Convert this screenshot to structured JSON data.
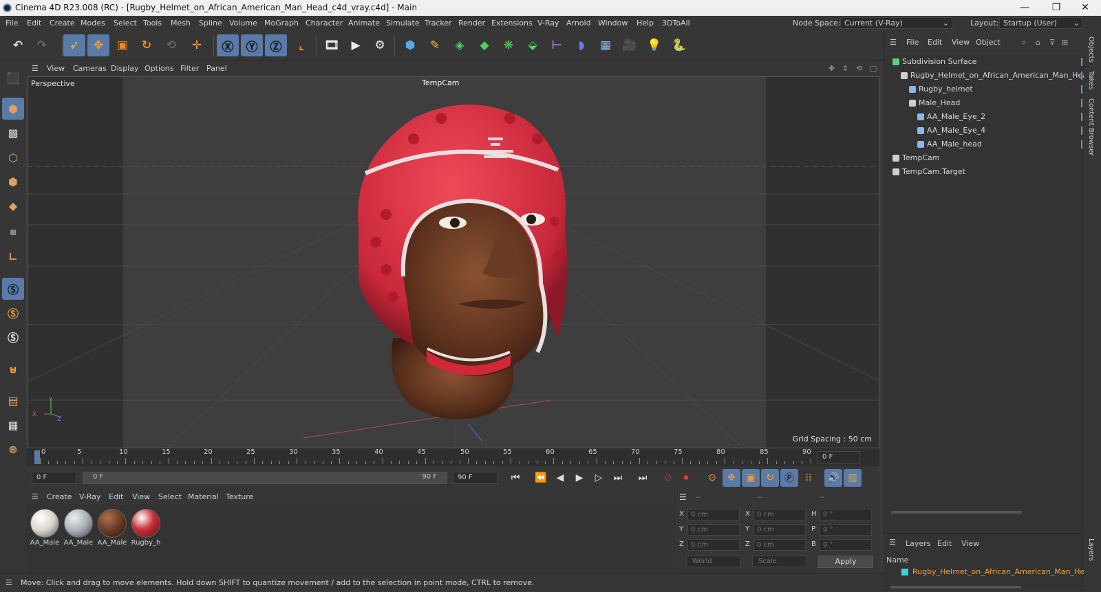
{
  "window": {
    "title": "Cinema 4D R23.008 (RC) - [Rugby_Helmet_on_African_American_Man_Head_c4d_vray.c4d] - Main"
  },
  "menu": [
    "File",
    "Edit",
    "Create",
    "Modes",
    "Select",
    "Tools",
    "Mesh",
    "Spline",
    "Volume",
    "MoGraph",
    "Character",
    "Animate",
    "Simulate",
    "Tracker",
    "Render",
    "Extensions",
    "V-Ray",
    "Arnold",
    "Window",
    "Help",
    "3DToAll"
  ],
  "node_space": {
    "label": "Node Space:",
    "value": "Current (V-Ray)"
  },
  "layout": {
    "label": "Layout:",
    "value": "Startup (User)"
  },
  "viewport_menu": [
    "View",
    "Cameras",
    "Display",
    "Options",
    "Filter",
    "Panel"
  ],
  "viewport": {
    "name": "Perspective",
    "camera": "TempCam",
    "grid_spacing": "Grid Spacing : 50 cm",
    "axis_x": "X",
    "axis_y": "Y",
    "axis_z": "Z"
  },
  "timeline": {
    "ticks": [
      "0",
      "5",
      "10",
      "15",
      "20",
      "25",
      "30",
      "35",
      "40",
      "45",
      "50",
      "55",
      "60",
      "65",
      "70",
      "75",
      "80",
      "85",
      "90"
    ],
    "current": "0 F"
  },
  "playback": {
    "start": "0 F",
    "range_start": "0 F",
    "range_end": "90 F",
    "end": "90 F"
  },
  "material_menu": [
    "Create",
    "V-Ray",
    "Edit",
    "View",
    "Select",
    "Material",
    "Texture"
  ],
  "materials": [
    {
      "name": "AA_Male",
      "color": "#d8d4cc"
    },
    {
      "name": "AA_Male",
      "color": "#a8b0b8"
    },
    {
      "name": "AA_Male",
      "color": "#6a3a22"
    },
    {
      "name": "Rugby_h",
      "color": "#c83038"
    }
  ],
  "coords": {
    "headers": [
      "--",
      "--",
      "--"
    ],
    "pos_labels": [
      "X",
      "Y",
      "Z"
    ],
    "pos_values": [
      "0 cm",
      "0 cm",
      "0 cm"
    ],
    "size_labels": [
      "X",
      "Y",
      "Z"
    ],
    "size_values": [
      "0 cm",
      "0 cm",
      "0 cm"
    ],
    "rot_labels": [
      "H",
      "P",
      "B"
    ],
    "rot_values": [
      "0 °",
      "0 °",
      "0 °"
    ],
    "world": "World",
    "scale": "Scale",
    "apply": "Apply"
  },
  "object_menu": [
    "File",
    "Edit",
    "View",
    "Object"
  ],
  "objects": [
    {
      "name": "Subdivision Surface",
      "indent": 0,
      "color": "#5ad07a"
    },
    {
      "name": "Rugby_Helmet_on_African_American_Man_Head",
      "indent": 1,
      "color": "#cfcfcf"
    },
    {
      "name": "Rugby_helmet",
      "indent": 2,
      "color": "#8ab8e8"
    },
    {
      "name": "Male_Head",
      "indent": 2,
      "color": "#cfcfcf"
    },
    {
      "name": "AA_Male_Eye_2",
      "indent": 3,
      "color": "#8ab8e8"
    },
    {
      "name": "AA_Male_Eye_4",
      "indent": 3,
      "color": "#8ab8e8"
    },
    {
      "name": "AA_Male_head",
      "indent": 3,
      "color": "#8ab8e8"
    },
    {
      "name": "TempCam",
      "indent": 0,
      "color": "#cfcfcf"
    },
    {
      "name": "TempCam.Target",
      "indent": 0,
      "color": "#cfcfcf"
    }
  ],
  "layers_menu": [
    "Layers",
    "Edit",
    "View"
  ],
  "layers_header": "Name",
  "layer_item": "Rugby_Helmet_on_African_American_Man_Head",
  "side_tabs": [
    "Objects",
    "Takes",
    "Content Browser",
    "Layers"
  ],
  "status": "Move: Click and drag to move elements. Hold down SHIFT to quantize movement / add to the selection in point mode, CTRL to remove."
}
